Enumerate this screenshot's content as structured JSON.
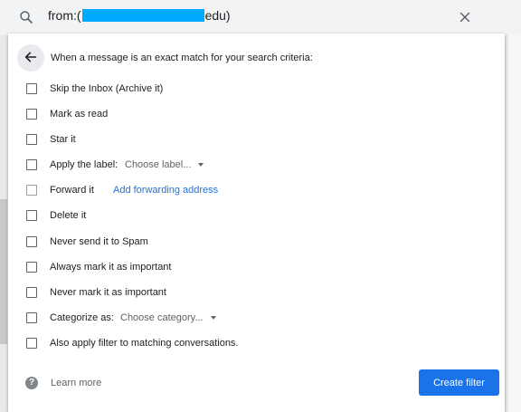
{
  "search": {
    "query_prefix": "from:(",
    "query_suffix": "edu)"
  },
  "panel": {
    "heading": "When a message is an exact match for your search criteria:",
    "options": [
      {
        "label": "Skip the Inbox (Archive it)"
      },
      {
        "label": "Mark as read"
      },
      {
        "label": "Star it"
      },
      {
        "label": "Apply the label:",
        "dropdown": "Choose label..."
      },
      {
        "label": "Forward it",
        "link": "Add forwarding address",
        "disabled": true
      },
      {
        "label": "Delete it"
      },
      {
        "label": "Never send it to Spam"
      },
      {
        "label": "Always mark it as important"
      },
      {
        "label": "Never mark it as important"
      },
      {
        "label": "Categorize as:",
        "dropdown": "Choose category..."
      },
      {
        "label": "Also apply filter to matching conversations."
      }
    ],
    "learn_more": "Learn more",
    "help_glyph": "?",
    "create_button": "Create filter"
  },
  "colors": {
    "accent": "#1a73e8",
    "redaction": "#00aaff"
  },
  "icons": [
    "search-icon",
    "close-icon",
    "arrow-left-icon",
    "help-icon",
    "chevron-down-icon"
  ]
}
